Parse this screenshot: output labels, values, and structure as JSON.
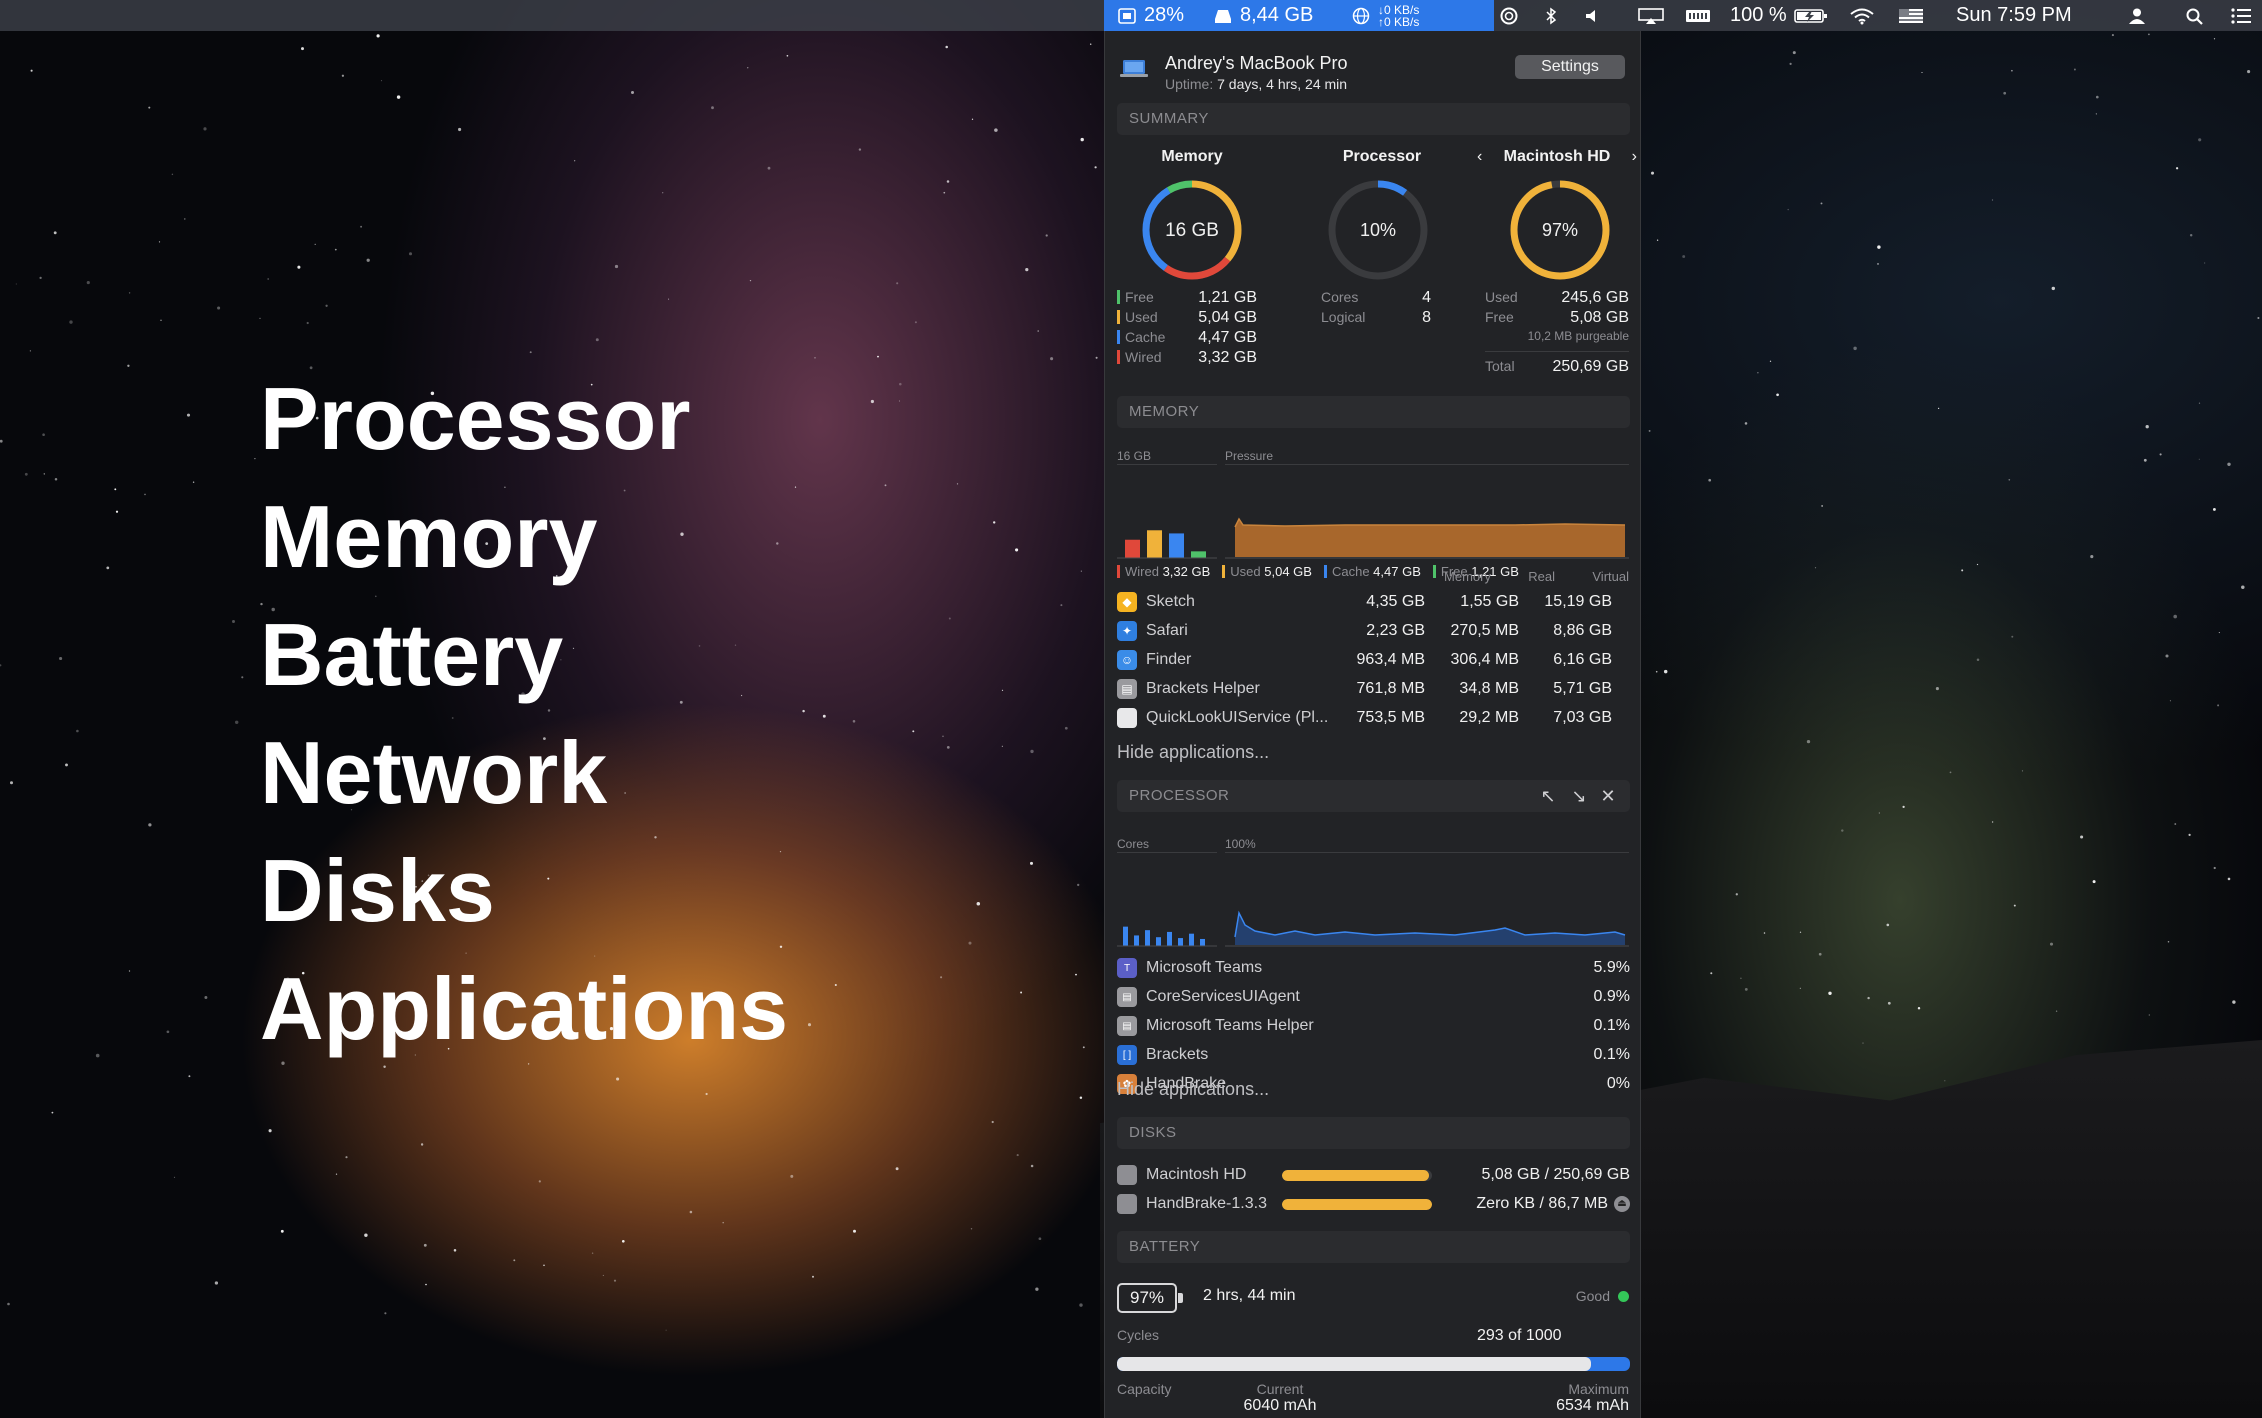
{
  "menubar": {
    "cpu": "28%",
    "memory": "8,44 GB",
    "net_up": "↓0 KB/s",
    "net_down": "↑0 KB/s",
    "battery_percent": "100 %",
    "clock": "Sun 7:59 PM",
    "icons": [
      "cpu-icon",
      "disk-icon",
      "globe-icon",
      "radar-icon",
      "bluetooth-icon",
      "volume-icon",
      "airplay-icon",
      "memory-icon",
      "battery-icon",
      "wifi-icon",
      "flag-icon",
      "user-icon",
      "search-icon",
      "list-icon"
    ]
  },
  "promo": {
    "items": [
      "Processor",
      "Memory",
      "Battery",
      "Network",
      "Disks",
      "Applications"
    ]
  },
  "header": {
    "machine_name": "Andrey's MacBook Pro",
    "uptime_label": "Uptime:",
    "uptime_value": "7 days, 4 hrs, 24 min",
    "settings_label": "Settings"
  },
  "summary": {
    "section_title": "SUMMARY",
    "memory": {
      "title": "Memory",
      "center": "16 GB",
      "rows": [
        {
          "label": "Free",
          "value": "1,21 GB",
          "color": "#4fc26a"
        },
        {
          "label": "Used",
          "value": "5,04 GB",
          "color": "#f0b23a"
        },
        {
          "label": "Cache",
          "value": "4,47 GB",
          "color": "#3a86f0"
        },
        {
          "label": "Wired",
          "value": "3,32 GB",
          "color": "#e0483a"
        }
      ]
    },
    "processor": {
      "title": "Processor",
      "center": "10%",
      "level": 0.1,
      "rows": [
        {
          "label": "Cores",
          "value": "4"
        },
        {
          "label": "Logical",
          "value": "8"
        }
      ]
    },
    "disk": {
      "title": "Macintosh HD",
      "center": "97%",
      "level": 0.97,
      "used_label": "Used",
      "used_value": "245,6 GB",
      "free_label": "Free",
      "free_value": "5,08 GB",
      "purgeable": "10,2 MB purgeable",
      "total_label": "Total",
      "total_value": "250,69 GB"
    }
  },
  "memory_section": {
    "section_title": "MEMORY",
    "chart_left_label": "16 GB",
    "chart_right_label": "Pressure",
    "legend": [
      {
        "label": "Wired",
        "value": "3,32 GB",
        "color": "#e0483a"
      },
      {
        "label": "Used",
        "value": "5,04 GB",
        "color": "#f0b23a"
      },
      {
        "label": "Cache",
        "value": "4,47 GB",
        "color": "#3a86f0"
      },
      {
        "label": "Free",
        "value": "1,21 GB",
        "color": "#4fc26a"
      }
    ],
    "columns": [
      "Memory",
      "Real",
      "Virtual"
    ],
    "apps": [
      {
        "name": "Sketch",
        "memory": "4,35 GB",
        "real": "1,55 GB",
        "virtual": "15,19 GB",
        "icon": "sketch-icon",
        "color": "#f5b321",
        "glyph": "◆"
      },
      {
        "name": "Safari",
        "memory": "2,23 GB",
        "real": "270,5 MB",
        "virtual": "8,86 GB",
        "icon": "safari-icon",
        "color": "#2f7fe0",
        "glyph": "✦"
      },
      {
        "name": "Finder",
        "memory": "963,4 MB",
        "real": "306,4 MB",
        "virtual": "6,16 GB",
        "icon": "finder-icon",
        "color": "#3a8ce8",
        "glyph": "☺"
      },
      {
        "name": "Brackets Helper",
        "memory": "761,8 MB",
        "real": "34,8 MB",
        "virtual": "5,71 GB",
        "icon": "brackets-helper-icon",
        "color": "#9a9a9e",
        "glyph": "▤"
      },
      {
        "name": "QuickLookUIService (Pl...",
        "memory": "753,5 MB",
        "real": "29,2 MB",
        "virtual": "7,03 GB",
        "icon": "document-icon",
        "color": "#e8e8ea",
        "glyph": ""
      }
    ],
    "hide_label": "Hide applications..."
  },
  "processor_section": {
    "section_title": "PROCESSOR",
    "chart_left_label": "Cores",
    "chart_right_label": "100%",
    "apps": [
      {
        "name": "Microsoft Teams",
        "value": "5.9%",
        "icon": "teams-icon",
        "color": "#5b5fc7",
        "glyph": "T"
      },
      {
        "name": "CoreServicesUIAgent",
        "value": "0.9%",
        "icon": "app-generic-icon",
        "color": "#9a9a9e",
        "glyph": "▤"
      },
      {
        "name": "Microsoft Teams Helper",
        "value": "0.1%",
        "icon": "app-generic-icon",
        "color": "#9a9a9e",
        "glyph": "▤"
      },
      {
        "name": "Brackets",
        "value": "0.1%",
        "icon": "brackets-icon",
        "color": "#2a6fd6",
        "glyph": "[ ]"
      },
      {
        "name": "HandBrake",
        "value": "0%",
        "icon": "handbrake-icon",
        "color": "#d8803a",
        "glyph": "✿"
      }
    ],
    "hide_label": "Hide applications..."
  },
  "disks_section": {
    "section_title": "DISKS",
    "disks": [
      {
        "name": "Macintosh HD",
        "value": "5,08 GB / 250,69 GB",
        "fill": 0.98
      },
      {
        "name": "HandBrake-1.3.3",
        "value": "Zero KB / 86,7 MB",
        "fill": 1.0
      }
    ]
  },
  "battery_section": {
    "section_title": "BATTERY",
    "percent": "97%",
    "time": "2 hrs, 44 min",
    "health": "Good",
    "health_color": "#34c759",
    "cycles_label": "Cycles",
    "cycles_value": "293 of 1000",
    "cycles_level": 0.293,
    "capacity_label": "Capacity",
    "current_label": "Current",
    "current_value": "6040 mAh",
    "maximum_label": "Maximum",
    "maximum_value": "6534 mAh"
  },
  "colors": {
    "accent": "#2d78e8",
    "panel": "#222326",
    "orange": "#f0b23a",
    "red": "#e0483a",
    "blue": "#3a86f0",
    "green": "#4fc26a"
  }
}
